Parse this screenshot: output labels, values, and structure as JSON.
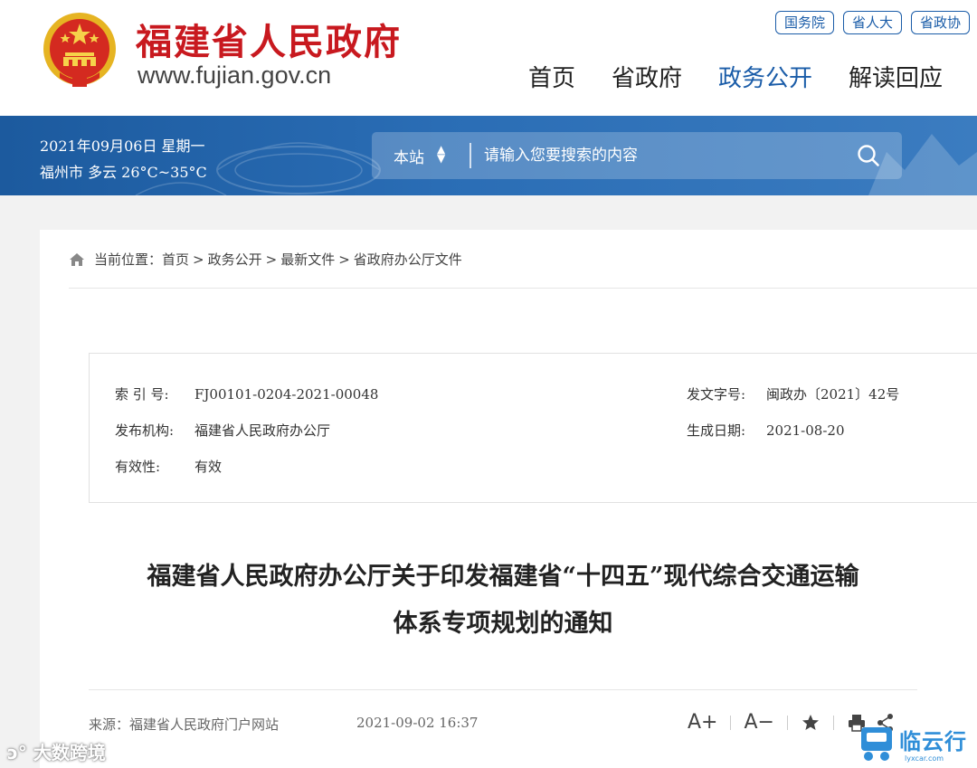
{
  "header": {
    "site_name": "福建省人民政府",
    "site_url": "www.fujian.gov.cn",
    "top_links": [
      "国务院",
      "省人大",
      "省政协"
    ],
    "nav": [
      {
        "label": "首页",
        "active": false
      },
      {
        "label": "省政府",
        "active": false
      },
      {
        "label": "政务公开",
        "active": true
      },
      {
        "label": "解读回应",
        "active": false
      }
    ]
  },
  "band": {
    "date": "2021年09月06日 星期一",
    "weather": "福州市 多云 26°C~35°C",
    "search": {
      "scope": "本站",
      "placeholder": "请输入您要搜索的内容"
    }
  },
  "breadcrumb": {
    "prefix": "当前位置：",
    "items": [
      "首页",
      "政务公开",
      "最新文件",
      "省政府办公厅文件"
    ],
    "separator": ">"
  },
  "meta": {
    "index_label": "索 引 号:",
    "index_value": "FJ00101-0204-2021-00048",
    "doc_no_label": "发文字号:",
    "doc_no_value": "闽政办〔2021〕42号",
    "issuer_label": "发布机构:",
    "issuer_value": "福建省人民政府办公厅",
    "created_label": "生成日期:",
    "created_value": "2021-08-20",
    "validity_label": "有效性:",
    "validity_value": "有效"
  },
  "article": {
    "title_line1": "福建省人民政府办公厅关于印发福建省“十四五”现代综合交通运输",
    "title_line2": "体系专项规划的通知",
    "source": "来源：福建省人民政府门户网站",
    "published": "2021-09-02 16:37"
  },
  "tools": {
    "font_up": "A+",
    "font_down": "A−"
  },
  "watermarks": {
    "left": "大数跨境",
    "right": "临云行",
    "right_sub": "lyxcar.com"
  },
  "colors": {
    "brand_red": "#c8191f",
    "brand_blue": "#1a5ca8",
    "band_blue": "#2a6db5"
  }
}
